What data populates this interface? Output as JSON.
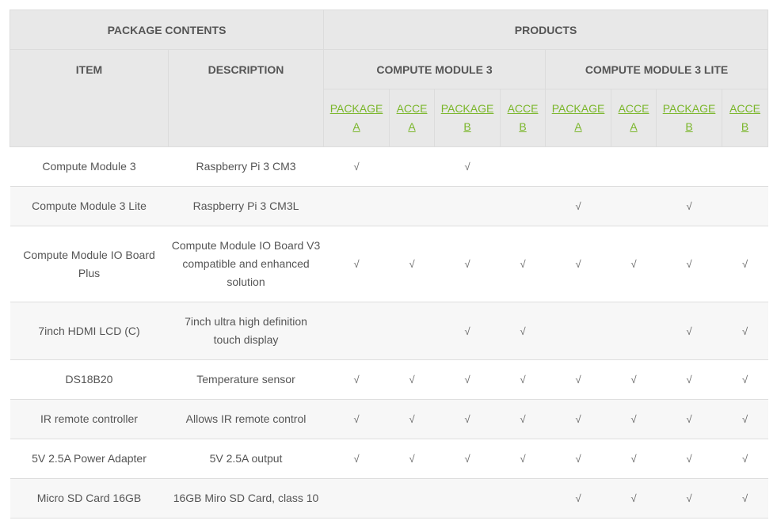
{
  "header": {
    "package_contents": "PACKAGE CONTENTS",
    "products": "PRODUCTS",
    "item": "ITEM",
    "description": "DESCRIPTION",
    "cm3": "COMPUTE MODULE 3",
    "cm3lite": "COMPUTE MODULE 3 LITE",
    "columns": [
      {
        "line1": "PACKAGE",
        "line2": "A"
      },
      {
        "line1": "ACCE",
        "line2": "A"
      },
      {
        "line1": "PACKAGE",
        "line2": "B"
      },
      {
        "line1": "ACCE",
        "line2": "B"
      },
      {
        "line1": "PACKAGE",
        "line2": "A"
      },
      {
        "line1": "ACCE",
        "line2": "A"
      },
      {
        "line1": "PACKAGE",
        "line2": "B"
      },
      {
        "line1": "ACCE",
        "line2": "B"
      }
    ]
  },
  "check_mark": "√",
  "rows": [
    {
      "item": "Compute Module 3",
      "description": "Raspberry Pi 3 CM3",
      "checks": [
        true,
        false,
        true,
        false,
        false,
        false,
        false,
        false
      ]
    },
    {
      "item": "Compute Module 3 Lite",
      "description": "Raspberry Pi 3 CM3L",
      "checks": [
        false,
        false,
        false,
        false,
        true,
        false,
        true,
        false
      ]
    },
    {
      "item": "Compute Module IO Board Plus",
      "description": "Compute Module IO Board V3 compatible and enhanced solution",
      "checks": [
        true,
        true,
        true,
        true,
        true,
        true,
        true,
        true
      ]
    },
    {
      "item": "7inch HDMI LCD (C)",
      "description": "7inch ultra high definition touch display",
      "checks": [
        false,
        false,
        true,
        true,
        false,
        false,
        true,
        true
      ]
    },
    {
      "item": "DS18B20",
      "description": "Temperature sensor",
      "checks": [
        true,
        true,
        true,
        true,
        true,
        true,
        true,
        true
      ]
    },
    {
      "item": "IR remote controller",
      "description": "Allows IR remote control",
      "checks": [
        true,
        true,
        true,
        true,
        true,
        true,
        true,
        true
      ]
    },
    {
      "item": "5V 2.5A Power Adapter",
      "description": "5V 2.5A output",
      "checks": [
        true,
        true,
        true,
        true,
        true,
        true,
        true,
        true
      ]
    },
    {
      "item": "Micro SD Card 16GB",
      "description": "16GB Miro SD Card, class 10",
      "checks": [
        false,
        false,
        false,
        false,
        true,
        true,
        true,
        true
      ]
    }
  ]
}
